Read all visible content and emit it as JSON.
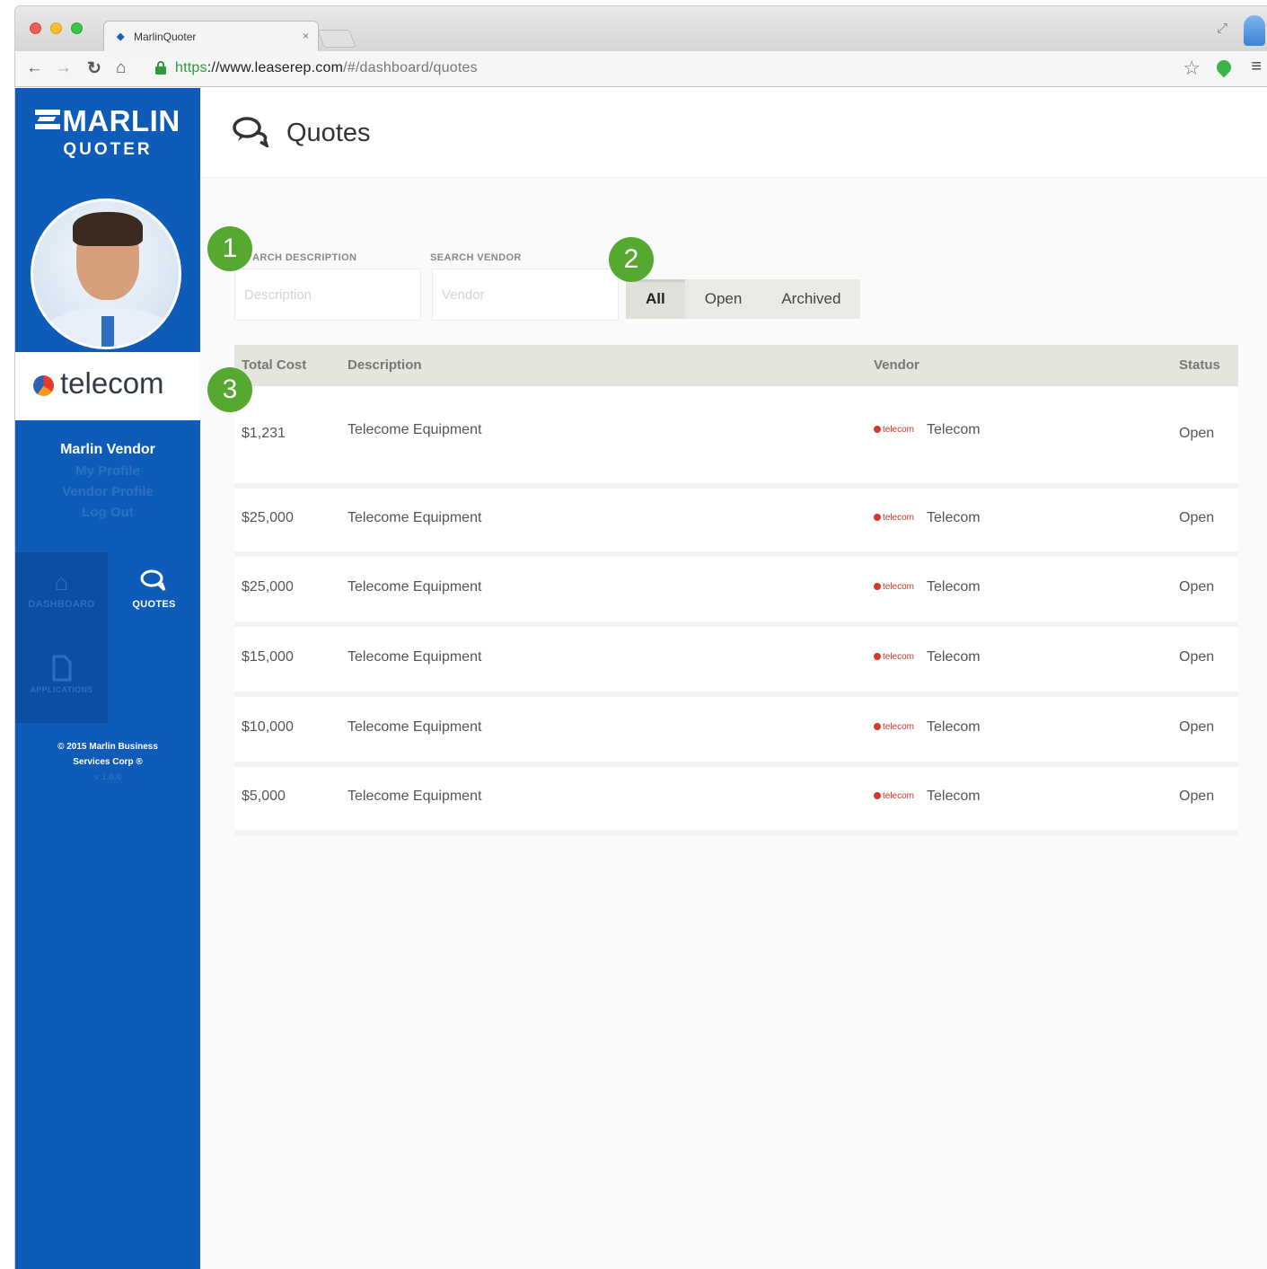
{
  "browser": {
    "tab_title": "MarlinQuoter",
    "tab_favicon": "marlin-icon",
    "url_scheme": "https",
    "url_host": "://www.leaserep.com",
    "url_path": "/#/dashboard/quotes"
  },
  "sidebar": {
    "logo_main": "MARLIN",
    "logo_sub": "QUOTER",
    "company_name": "telecom",
    "user_name": "Marlin Vendor",
    "links": [
      "My Profile",
      "Vendor Profile",
      "Log Out"
    ],
    "nav": {
      "dashboard_label": "DASHBOARD",
      "quotes_label": "QUOTES",
      "application_label": "APPLICATIONS"
    },
    "copyright_line1": "© 2015 Marlin Business",
    "copyright_line2": "Services Corp ®",
    "version": "v 1.0.0"
  },
  "header": {
    "title": "Quotes",
    "icon": "chat-bubbles-icon"
  },
  "search": {
    "description_label": "ARCH DESCRIPTION",
    "description_placeholder": "Description",
    "vendor_label": "SEARCH VENDOR",
    "vendor_placeholder": "Vendor"
  },
  "filters": {
    "all": "All",
    "open": "Open",
    "archived": "Archived",
    "selected": "All"
  },
  "table": {
    "headers": {
      "cost": "Total Cost",
      "description": "Description",
      "vendor": "Vendor",
      "status": "Status"
    },
    "rows": [
      {
        "cost": "$1,231",
        "description": "Telecome Equipment",
        "vendor_logo": "telecom",
        "vendor": "Telecom",
        "status": "Open"
      },
      {
        "cost": "$25,000",
        "description": "Telecome Equipment",
        "vendor_logo": "telecom",
        "vendor": "Telecom",
        "status": "Open"
      },
      {
        "cost": "$25,000",
        "description": "Telecome Equipment",
        "vendor_logo": "telecom",
        "vendor": "Telecom",
        "status": "Open"
      },
      {
        "cost": "$15,000",
        "description": "Telecome Equipment",
        "vendor_logo": "telecom",
        "vendor": "Telecom",
        "status": "Open"
      },
      {
        "cost": "$10,000",
        "description": "Telecome Equipment",
        "vendor_logo": "telecom",
        "vendor": "Telecom",
        "status": "Open"
      },
      {
        "cost": "$5,000",
        "description": "Telecome Equipment",
        "vendor_logo": "telecom",
        "vendor": "Telecom",
        "status": "Open"
      }
    ]
  },
  "steps": [
    "1",
    "2",
    "3"
  ]
}
